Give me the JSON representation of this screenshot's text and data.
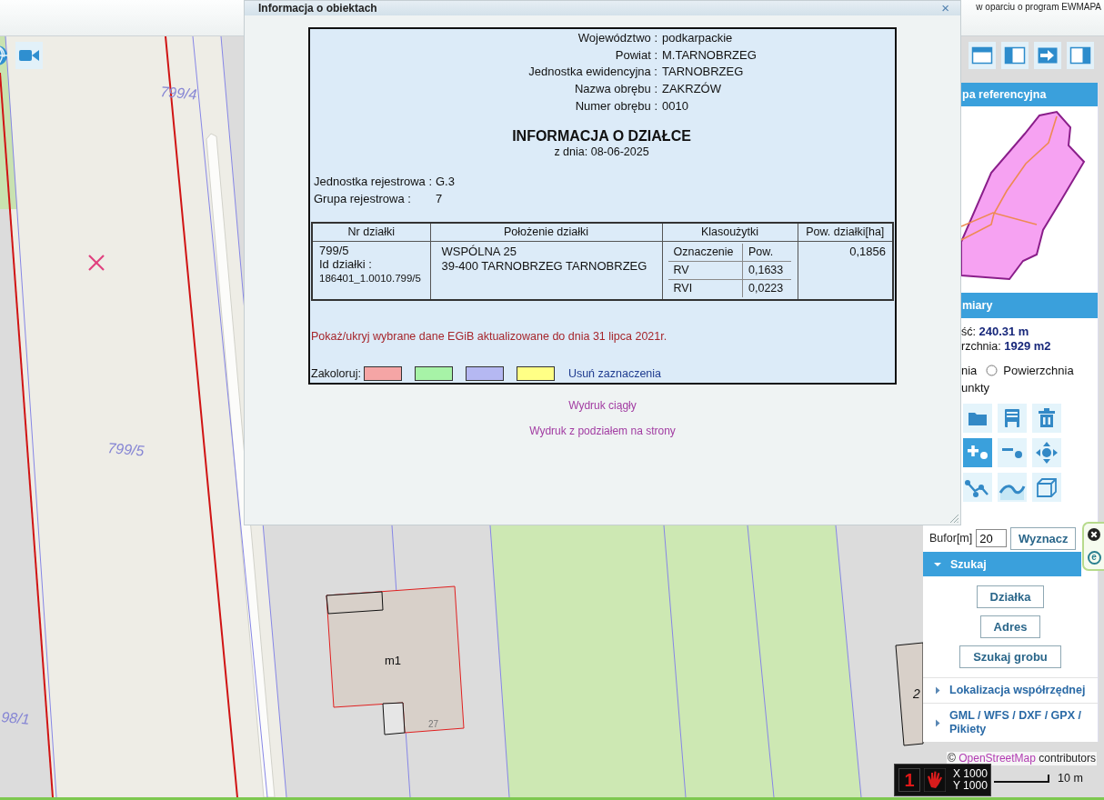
{
  "top_bar": {
    "credit": "w oparciu o program EWMAPA"
  },
  "map": {
    "parcel_labels": [
      "799/4",
      "799/5",
      "98/1"
    ],
    "building_labels": [
      "m1",
      "27",
      "2"
    ]
  },
  "dialog": {
    "title": "Informacja o obiektach",
    "close": "×",
    "admin_fields": [
      {
        "label": "Województwo :",
        "value": "podkarpackie"
      },
      {
        "label": "Powiat :",
        "value": "M.TARNOBRZEG"
      },
      {
        "label": "Jednostka ewidencyjna :",
        "value": "TARNOBRZEG"
      },
      {
        "label": "Nazwa obrębu :",
        "value": "ZAKRZÓW"
      },
      {
        "label": "Numer obrębu :",
        "value": "0010"
      }
    ],
    "heading": "INFORMACJA O DZIAŁCE",
    "date": "z dnia: 08-06-2025",
    "register_fields": [
      {
        "label": "Jednostka rejestrowa :",
        "value": "G.3"
      },
      {
        "label": "Grupa rejestrowa :",
        "value": "7"
      }
    ],
    "table": {
      "columns": [
        "Nr działki",
        "Położenie działki",
        "Klasoużytki",
        "Pow. działki[ha]"
      ],
      "rows": [
        {
          "parcel_number": "799/5",
          "id_label": "Id działki :",
          "parcel_id": "186401_1.0010.799/5",
          "address": [
            "WSPÓLNA 25",
            "39-400 TARNOBRZEG TARNOBRZEG"
          ],
          "land_use": {
            "columns": [
              "Oznaczenie",
              "Pow."
            ],
            "rows": [
              [
                "RV",
                "0,1633"
              ],
              [
                "RVI",
                "0,0223"
              ]
            ]
          },
          "area": "0,1856"
        }
      ]
    },
    "egib_link": "Pokaż/ukryj wybrane dane EGiB aktualizowane do dnia 31 lipca 2021r.",
    "colorize": {
      "label": "Zakoloruj:",
      "swatches": [
        {
          "color": "#f5a5a5"
        },
        {
          "color": "#a7f3a7"
        },
        {
          "color": "#b5b8f2"
        },
        {
          "color": "#ffff85"
        }
      ],
      "clear_link": "Usuń zaznaczenia"
    },
    "print_links": [
      "Wydruk ciągły",
      "Wydruk z podziałem na strony"
    ]
  },
  "side_panel": {
    "reference_map": {
      "title": "pa referencyjna"
    },
    "measurements": {
      "title": "miary",
      "readings": [
        {
          "label": "ść:",
          "value": "240.31 m"
        },
        {
          "label": "rzchnia:",
          "value": "1929 m2"
        }
      ],
      "mode_label": "nia",
      "area_option": {
        "label": "Powierzchnia",
        "selected": false
      },
      "points_label": "unkty",
      "tools": [
        {
          "selected": false
        },
        {
          "selected": false
        },
        {
          "selected": false
        },
        {
          "selected": true
        },
        {
          "selected": false
        },
        {
          "selected": false
        },
        {
          "selected": false
        },
        {
          "selected": false
        },
        {
          "selected": false
        }
      ],
      "buffer": {
        "label": "Bufor[m]",
        "value": "20"
      },
      "compute_button": "Wyznacz"
    },
    "search": {
      "title": "Szukaj",
      "expanded": true,
      "buttons": [
        "Działka",
        "Adres",
        "Szukaj grobu"
      ]
    },
    "sections": [
      {
        "title": "Lokalizacja współrzędnej",
        "expanded": false
      },
      {
        "title": "GML / WFS / DXF / GPX / Pikiety",
        "expanded": false
      }
    ]
  },
  "edge_tab": {
    "badge": "e"
  },
  "attribution": {
    "before": "©",
    "link": "OpenStreetMap",
    "after": "contributors"
  },
  "coordinates": {
    "digit": "1",
    "x": "X 1000",
    "y": "Y 1000"
  },
  "scale": {
    "label": "10 m"
  }
}
